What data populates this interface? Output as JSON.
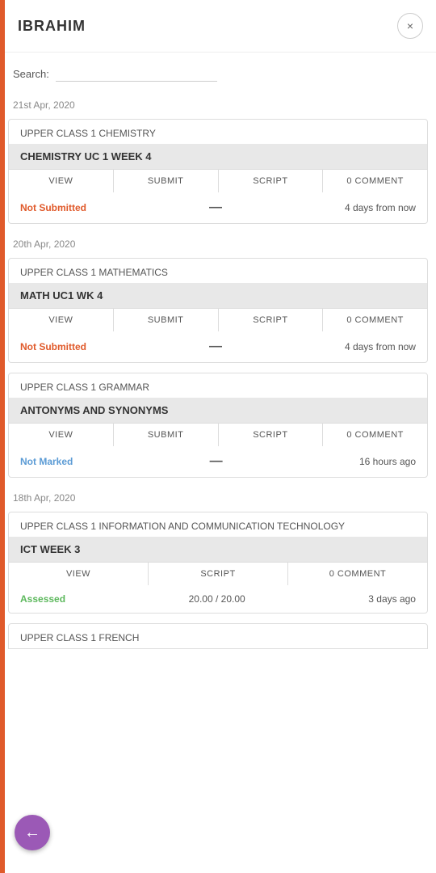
{
  "header": {
    "title": "IBRAHIM",
    "close_label": "×"
  },
  "search": {
    "label": "Search:",
    "placeholder": ""
  },
  "cards": [
    {
      "date": "21st Apr, 2020",
      "subject": "UPPER CLASS 1 CHEMISTRY",
      "title": "CHEMISTRY UC 1 WEEK 4",
      "actions": [
        "VIEW",
        "SUBMIT",
        "SCRIPT",
        "0 COMMENT"
      ],
      "status_type": "not-submitted",
      "status": "Not Submitted",
      "dash": "—",
      "time": "4 days from now"
    },
    {
      "date": "20th Apr, 2020",
      "subject": "UPPER CLASS 1 MATHEMATICS",
      "title": "MATH UC1 WK 4",
      "actions": [
        "VIEW",
        "SUBMIT",
        "SCRIPT",
        "0 COMMENT"
      ],
      "status_type": "not-submitted",
      "status": "Not Submitted",
      "dash": "—",
      "time": "4 days from now"
    },
    {
      "date": "",
      "subject": "UPPER CLASS 1 GRAMMAR",
      "title": "ANTONYMS AND SYNONYMS",
      "actions": [
        "VIEW",
        "SUBMIT",
        "SCRIPT",
        "0 COMMENT"
      ],
      "status_type": "not-marked",
      "status": "Not Marked",
      "dash": "—",
      "time": "16 hours ago"
    },
    {
      "date": "18th Apr, 2020",
      "subject": "UPPER CLASS 1 INFORMATION AND COMMUNICATION TECHNOLOGY",
      "title": "ICT WEEK 3",
      "actions": [
        "VIEW",
        "SCRIPT",
        "0 COMMENT"
      ],
      "status_type": "assessed",
      "status": "Assessed",
      "score": "20.00 / 20.00",
      "time": "3 days ago"
    }
  ],
  "bottom_card": {
    "subject": "UPPER CLASS 1 FRENCH"
  },
  "back_button": {
    "icon": "←"
  }
}
